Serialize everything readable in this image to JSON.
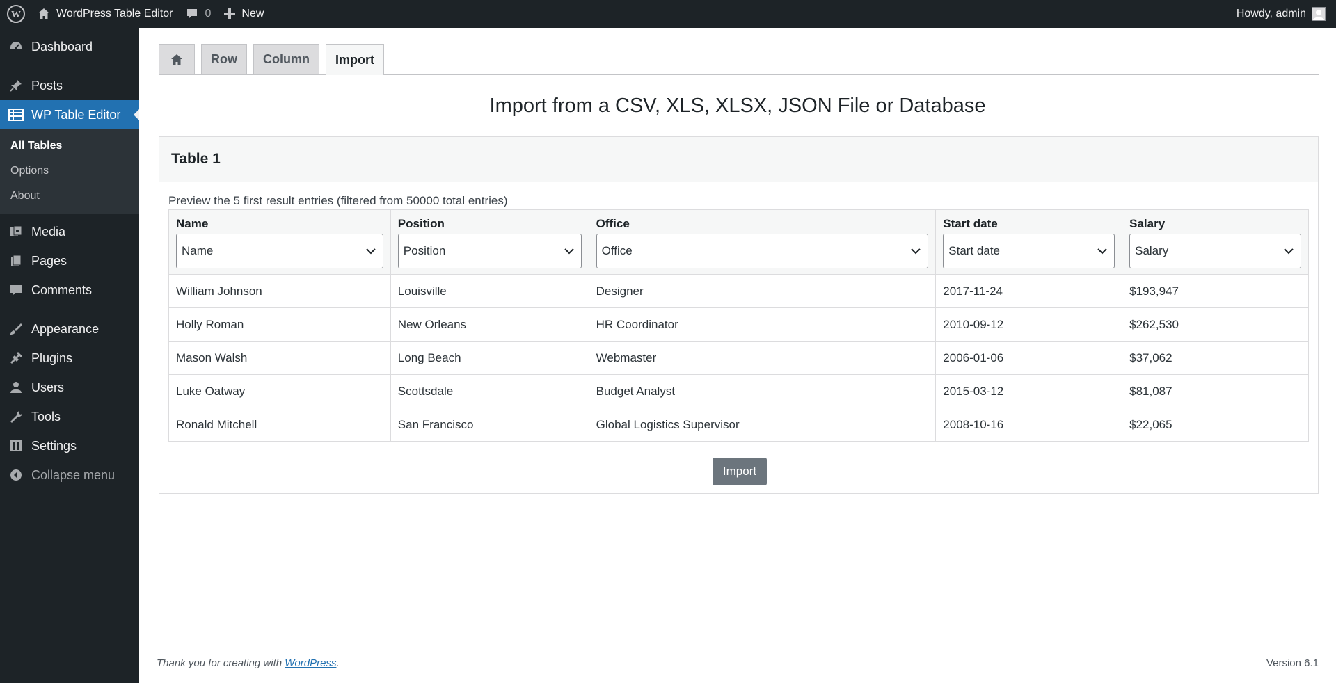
{
  "adminbar": {
    "site_name": "WordPress Table Editor",
    "comments_count": "0",
    "new_label": "New",
    "howdy": "Howdy, admin"
  },
  "sidebar": {
    "items": [
      {
        "label": "Dashboard",
        "icon": "dashboard-icon"
      },
      {
        "label": "Posts",
        "icon": "pin-icon"
      },
      {
        "label": "WP Table Editor",
        "icon": "table-icon"
      },
      {
        "label": "Media",
        "icon": "media-icon"
      },
      {
        "label": "Pages",
        "icon": "pages-icon"
      },
      {
        "label": "Comments",
        "icon": "comment-icon"
      },
      {
        "label": "Appearance",
        "icon": "brush-icon"
      },
      {
        "label": "Plugins",
        "icon": "plug-icon"
      },
      {
        "label": "Users",
        "icon": "user-icon"
      },
      {
        "label": "Tools",
        "icon": "wrench-icon"
      },
      {
        "label": "Settings",
        "icon": "settings-icon"
      },
      {
        "label": "Collapse menu",
        "icon": "collapse-icon"
      }
    ],
    "submenu": [
      "All Tables",
      "Options",
      "About"
    ]
  },
  "tabs": [
    "Row",
    "Column",
    "Import"
  ],
  "page_title": "Import from a CSV, XLS, XLSX, JSON File or Database",
  "panel": {
    "title": "Table 1",
    "preview_note": "Preview the 5 first result entries (filtered from 50000 total entries)"
  },
  "table": {
    "headers": [
      "Name",
      "Position",
      "Office",
      "Start date",
      "Salary"
    ],
    "selects": [
      "Name",
      "Position",
      "Office",
      "Start date",
      "Salary"
    ],
    "rows": [
      [
        "William Johnson",
        "Louisville",
        "Designer",
        "2017-11-24",
        "$193,947"
      ],
      [
        "Holly Roman",
        "New Orleans",
        "HR Coordinator",
        "2010-09-12",
        "$262,530"
      ],
      [
        "Mason Walsh",
        "Long Beach",
        "Webmaster",
        "2006-01-06",
        "$37,062"
      ],
      [
        "Luke Oatway",
        "Scottsdale",
        "Budget Analyst",
        "2015-03-12",
        "$81,087"
      ],
      [
        "Ronald Mitchell",
        "San Francisco",
        "Global Logistics Supervisor",
        "2008-10-16",
        "$22,065"
      ]
    ]
  },
  "import_button": "Import",
  "footer": {
    "thanks_prefix": "Thank you for creating with ",
    "thanks_link": "WordPress",
    "thanks_suffix": ".",
    "version": "Version 6.1"
  },
  "colors": {
    "admin_bg": "#1d2327",
    "accent": "#2271b1",
    "button": "#6c757d"
  }
}
